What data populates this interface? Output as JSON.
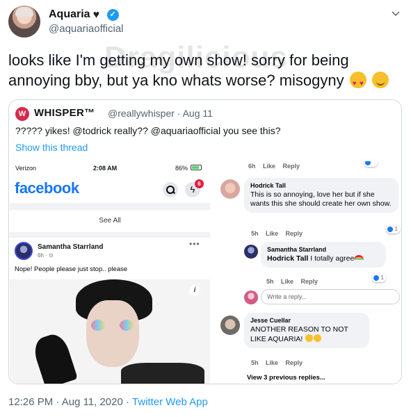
{
  "author": {
    "display_name": "Aquaria",
    "handle": "@aquariaofficial"
  },
  "watermark": "Dragilicious",
  "tweet_text": "looks like I'm getting my own show! sorry for being annoying bby, but ya kno whats worse? misogyny",
  "quote": {
    "name": "WHISPER™",
    "handle": "@reallywhisper",
    "date": "Aug 11",
    "meta": "@reallywhisper · Aug 11",
    "text": "????? yikes! @todrick really?? @aquariaofficial you see this?",
    "show_thread": "Show this thread"
  },
  "phone": {
    "carrier": "Verizon",
    "time": "2:08 AM",
    "battery": "86%",
    "app_logo": "facebook",
    "notification_count": "6",
    "see_all": "See All",
    "post": {
      "author": "Samantha Starrland",
      "time": "6h · ⊙",
      "text": "Nope! People please just stop.. please"
    }
  },
  "comments": {
    "top_actions": "6h Like Reply",
    "items": [
      {
        "name": "Hodrick Tall",
        "text": "This is so annoying, love her but if she wants this she should create her own show.",
        "actions": "5h Like Reply",
        "reactions": "1"
      },
      {
        "name": "Samantha Starrland",
        "mention": "Hodrick Tall",
        "text": "I totally agree",
        "actions": "5h Like Reply",
        "reactions": "1"
      },
      {
        "name": "Jesse Cuellar",
        "text": "ANOTHER REASON TO NOT LIKE AQUARIA!",
        "actions": "5h Like Reply"
      }
    ],
    "reply_placeholder": "Write a reply...",
    "view_previous": "View 3 previous replies..."
  },
  "footer": {
    "time": "12:26 PM · Aug 11, 2020 · ",
    "source": "Twitter Web App"
  },
  "colors": {
    "twitter_blue": "#1d9bf0",
    "facebook_blue": "#1877f2",
    "secondary_text": "#536471"
  }
}
